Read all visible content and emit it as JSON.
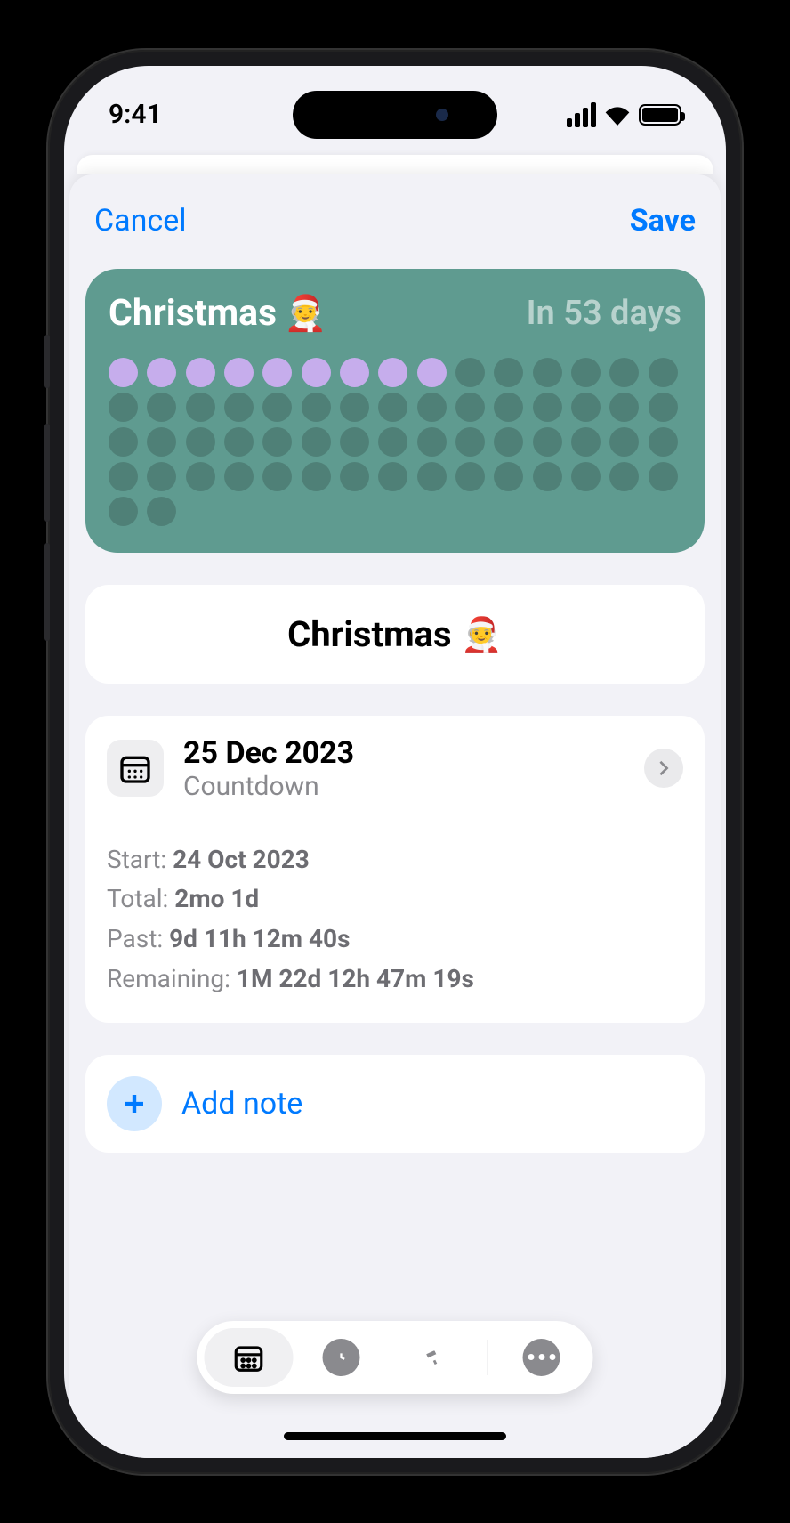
{
  "status_bar": {
    "time": "9:41"
  },
  "header": {
    "cancel": "Cancel",
    "save": "Save"
  },
  "widget": {
    "title": "Christmas",
    "emoji": "🧑‍🎄",
    "subtitle": "In 53 days",
    "dots_total": 62,
    "dots_filled": 9
  },
  "title_card": {
    "label": "Christmas",
    "emoji": "🧑‍🎄"
  },
  "date_card": {
    "date": "25 Dec 2023",
    "type": "Countdown",
    "stats": {
      "start_label": "Start:",
      "start_value": "24 Oct 2023",
      "total_label": "Total:",
      "total_value": "2mo 1d",
      "past_label": "Past:",
      "past_value": "9d 11h 12m 40s",
      "remaining_label": "Remaining:",
      "remaining_value": "1M 22d 12h 47m 19s"
    }
  },
  "add_note": {
    "label": "Add note"
  },
  "colors": {
    "accent": "#007aff",
    "widget_bg": "#5f9b90",
    "dot_fill": "#c6adec"
  }
}
